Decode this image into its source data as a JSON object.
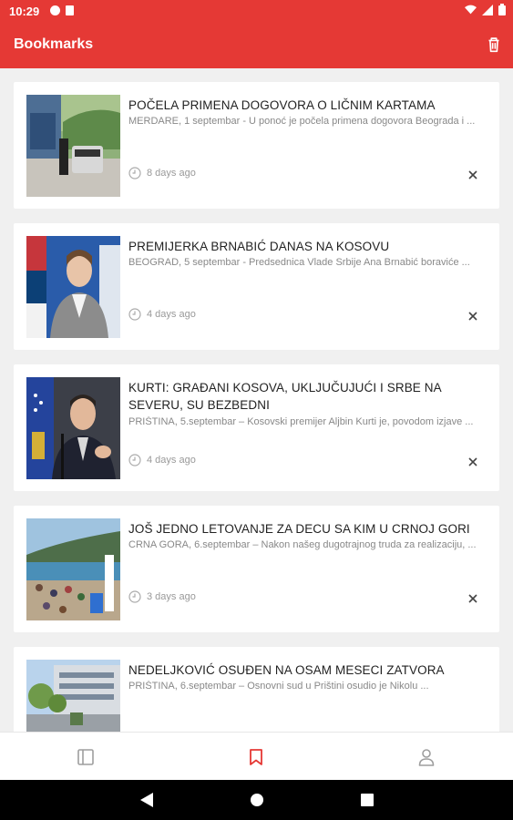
{
  "status_bar": {
    "time": "10:29"
  },
  "app_bar": {
    "title": "Bookmarks",
    "delete_all_icon": "trash-icon"
  },
  "bookmarks": [
    {
      "title": "POČELA PRIMENA DOGOVORA O LIČNIM KARTAMA",
      "excerpt": "MERDARE, 1 septembar - U ponoć je počela primena dogovora Beograda i ...",
      "time": "8 days ago",
      "image": "border-crossing-photo"
    },
    {
      "title": "PREMIJERKA BRNABIĆ DANAS NA KOSOVU",
      "excerpt": "BEOGRAD, 5 septembar - Predsednica Vlade Srbije Ana Brnabić boraviće ...",
      "time": "4 days ago",
      "image": "brnabic-photo"
    },
    {
      "title": "KURTI: GRAĐANI KOSOVA, UKLJUČUJUĆI I SRBE NA SEVERU, SU BEZBEDNI",
      "excerpt": "PRIŠTINA, 5.septembar – Kosovski premijer Aljbin Kurti je, povodom izjave ...",
      "time": "4 days ago",
      "image": "kurti-photo"
    },
    {
      "title": "JOŠ JEDNO LETOVANJE ZA DECU SA KIM U CRNOJ GORI",
      "excerpt": "CRNA GORA, 6.septembar – Nakon našeg dugotrajnog truda za realizaciju, ...",
      "time": "3 days ago",
      "image": "beach-photo"
    },
    {
      "title": "NEDELJKOVIĆ OSUĐEN NA OSAM MESECI ZATVORA",
      "excerpt": "PRIŠTINA, 6.septembar – Osnovni sud u Prištini osudio je Nikolu ...",
      "time": "",
      "image": "courthouse-photo"
    }
  ],
  "bottom_nav": [
    {
      "name": "news",
      "icon": "feed-icon",
      "active": false
    },
    {
      "name": "bookmarks",
      "icon": "bookmark-icon",
      "active": true
    },
    {
      "name": "profile",
      "icon": "person-icon",
      "active": false
    }
  ],
  "colors": {
    "accent": "#e53935",
    "inactive_icon": "#9e9e9e",
    "text": "#222222",
    "muted": "#888888"
  }
}
